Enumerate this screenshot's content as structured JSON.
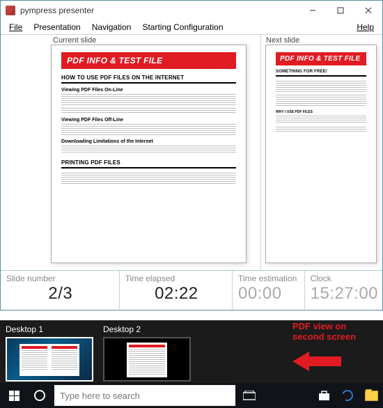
{
  "app": {
    "title": "pympress presenter",
    "menu": {
      "file": "File",
      "presentation": "Presentation",
      "navigation": "Navigation",
      "starting": "Starting Configuration",
      "help": "Help"
    },
    "panes": {
      "current_label": "Current slide",
      "next_label": "Next slide"
    },
    "status": {
      "slide_label": "Slide number",
      "slide_value": "2/3",
      "elapsed_label": "Time elapsed",
      "elapsed_value": "02:22",
      "estimation_label": "Time estimation",
      "estimation_value": "00:00",
      "clock_label": "Clock",
      "clock_value": "15:27:00"
    },
    "current_slide": {
      "banner": "PDF INFO & TEST FILE",
      "h1": "HOW TO USE PDF FILES ON THE INTERNET",
      "sub1": "Viewing PDF Files On-Line",
      "sub2": "Viewing PDF Files Off-Line",
      "sub3": "Downloading Limitations of the Internet",
      "h2": "PRINTING PDF FILES"
    },
    "next_slide": {
      "banner": "PDF INFO & TEST FILE",
      "h1": "SOMETHING FOR FREE!",
      "sub1": "WHY I USE PDF FILES"
    }
  },
  "taskview": {
    "desk1": "Desktop 1",
    "desk2": "Desktop 2"
  },
  "annotation": {
    "line1": "PDF view on",
    "line2": "second screen"
  },
  "taskbar": {
    "search_placeholder": "Type here to search"
  }
}
